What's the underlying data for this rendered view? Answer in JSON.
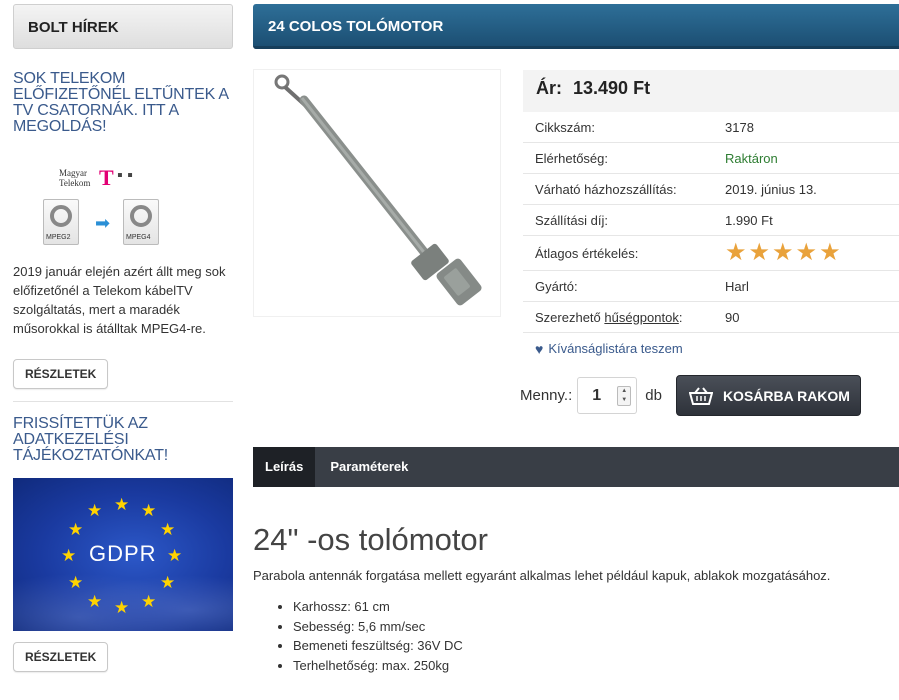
{
  "sidebar": {
    "header": "BOLT HÍREK",
    "news": [
      {
        "title": "SOK TELEKOM ELŐFIZETŐNÉL ELTŰNTEK A TV CSATORNÁK. ITT A MEGOLDÁS!",
        "image": {
          "brand_line1": "Magyar",
          "brand_line2": "Telekom",
          "logo_letter": "T",
          "from_label": "MPEG2",
          "to_label": "MPEG4"
        },
        "text": "2019 január elején azért állt meg sok előfizetőnél a Telekom kábelTV szolgáltatás, mert a maradék műsorokkal is átálltak MPEG4-re.",
        "button": "RÉSZLETEK"
      },
      {
        "title": "FRISSÍTETTÜK AZ ADATKEZELÉSI TÁJÉKOZTATÓNKAT!",
        "image": {
          "label": "GDPR"
        },
        "button": "RÉSZLETEK"
      }
    ]
  },
  "product": {
    "title": "24 COLOS TOLÓMOTOR",
    "price_label": "Ár:",
    "price": "13.490 Ft",
    "rows": [
      {
        "key": "Cikkszám:",
        "value": "3178"
      },
      {
        "key": "Elérhetőség:",
        "value": "Raktáron"
      },
      {
        "key": "Várható házhozszállítás:",
        "value": "2019. június 13."
      },
      {
        "key": "Szállítási díj:",
        "value": "1.990 Ft"
      },
      {
        "key": "Átlagos értékelés:",
        "rating": 5
      },
      {
        "key": "Gyártó:",
        "value": "Harl"
      },
      {
        "key_prefix": "Szerezhető ",
        "key_link": "hűségpontok",
        "key_suffix": ":",
        "value": "90"
      }
    ],
    "wishlist": "Kívánságlistára teszem",
    "qty_label": "Menny.:",
    "qty_value": "1",
    "qty_unit": "db",
    "cart_button": "KOSÁRBA RAKOM"
  },
  "tabs": [
    {
      "label": "Leírás",
      "active": true
    },
    {
      "label": "Paraméterek",
      "active": false
    }
  ],
  "description": {
    "heading": "24\" -os tolómotor",
    "text": "Parabola antennák forgatása mellett egyaránt alkalmas lehet például kapuk, ablakok mozgatásához.",
    "specs": [
      "Karhossz: 61 cm",
      "Sebesség: 5,6 mm/sec",
      "Bemeneti feszültség: 36V DC",
      "Terhelhetőség: max. 250kg"
    ]
  },
  "colors": {
    "title_bar": "#1f5a80",
    "link": "#3a5a8c",
    "in_stock": "#2e7d32",
    "star": "#e9a23b",
    "tabs_bg": "#393e46"
  }
}
